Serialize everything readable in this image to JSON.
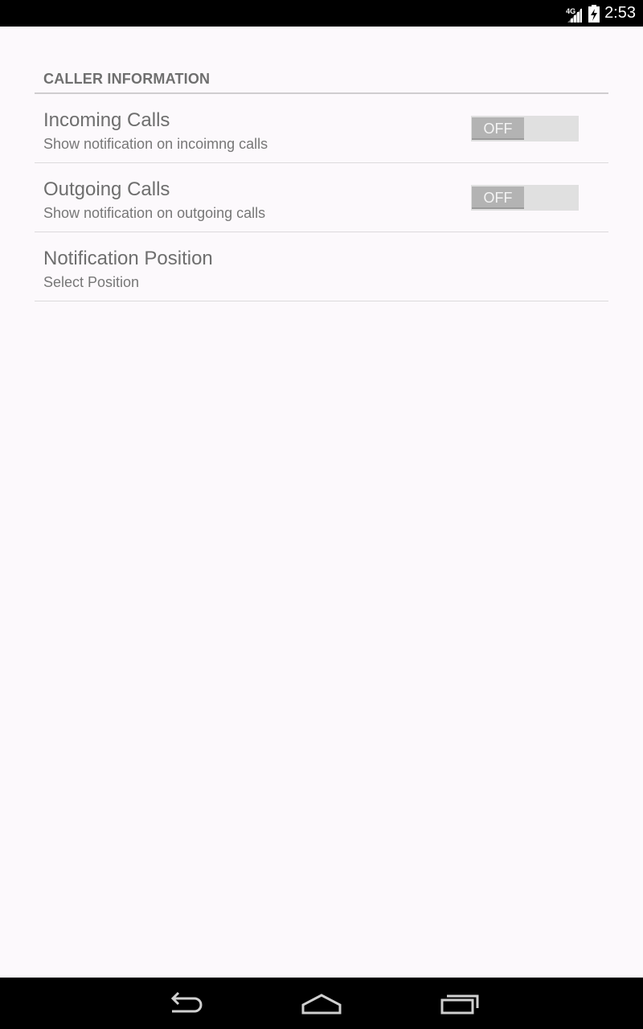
{
  "status_bar": {
    "network": "4G",
    "time": "2:53",
    "icons": [
      "signal-icon",
      "battery-charging-icon"
    ]
  },
  "section": {
    "header": "CALLER INFORMATION"
  },
  "preferences": [
    {
      "title": "Incoming Calls",
      "summary": "Show notification on incoimng calls",
      "toggle": "OFF"
    },
    {
      "title": "Outgoing Calls",
      "summary": "Show notification on outgoing calls",
      "toggle": "OFF"
    },
    {
      "title": "Notification Position",
      "summary": "Select Position"
    }
  ],
  "nav_bar": {
    "icons": [
      "back-icon",
      "home-icon",
      "recent-apps-icon"
    ]
  },
  "colors": {
    "background": "#fcf9fc",
    "status_bar": "#000000",
    "nav_bar": "#000000",
    "text_primary": "#6e6e6e",
    "toggle_track": "#e0e0e0",
    "toggle_thumb": "#b3b3b3"
  }
}
